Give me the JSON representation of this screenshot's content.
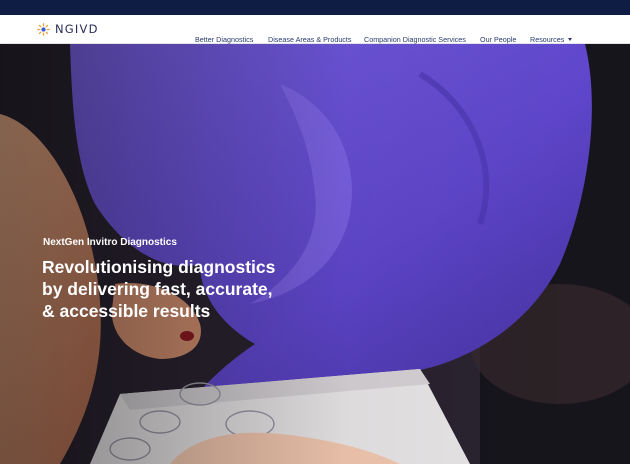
{
  "brand": {
    "name": "NGIVD",
    "logo_icon": "sun-burst-logo-icon",
    "dot_color": "#3b5bd9",
    "ray_color": "#e7a43a"
  },
  "colors": {
    "topbar": "#0f1d45",
    "nav_text": "#2a3a6d",
    "glove": "#6b52d6"
  },
  "nav": {
    "items": [
      {
        "label": "Better Diagnostics"
      },
      {
        "label": "Disease Areas & Products"
      },
      {
        "label": "Companion Diagnostic Services"
      },
      {
        "label": "Our People"
      },
      {
        "label": "Resources",
        "has_dropdown": true
      }
    ]
  },
  "hero": {
    "kicker": "NextGen Invitro Diagnostics",
    "headline_line1": "Revolutionising diagnostics",
    "headline_line2": "by delivering fast, accurate,",
    "headline_line3": "& accessible results"
  }
}
